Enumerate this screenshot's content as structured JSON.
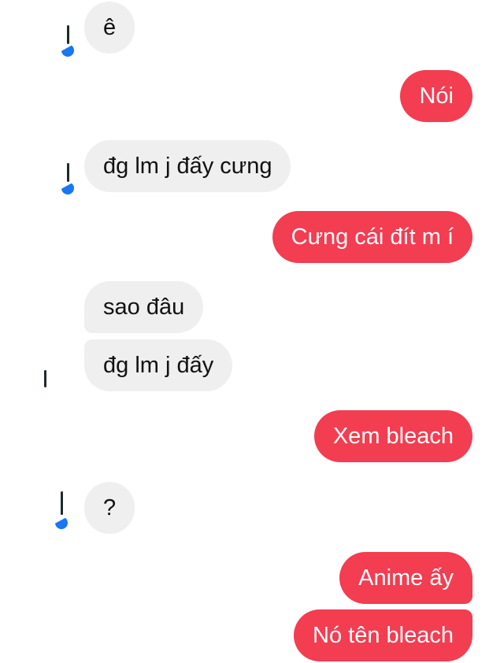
{
  "conversation": {
    "messages": [
      {
        "from": "them",
        "text": "ê"
      },
      {
        "from": "me",
        "text": "Nói"
      },
      {
        "from": "them",
        "text": "đg lm j đấy cưng"
      },
      {
        "from": "me",
        "text": "Cưng cái đít m í"
      },
      {
        "from": "them",
        "text": "sao đâu"
      },
      {
        "from": "them",
        "text": "đg lm j đấy"
      },
      {
        "from": "me",
        "text": "Xem bleach"
      },
      {
        "from": "them",
        "text": "?"
      },
      {
        "from": "me",
        "text": "Anime ấy"
      },
      {
        "from": "me",
        "text": "Nó tên bleach"
      }
    ]
  },
  "colors": {
    "incoming_bubble": "#efefef",
    "outgoing_bubble": "#f33d51",
    "presence_badge": "#1877f2"
  },
  "icons": {
    "avatar": "contact-avatar-icon",
    "presence": "active-status-icon"
  }
}
